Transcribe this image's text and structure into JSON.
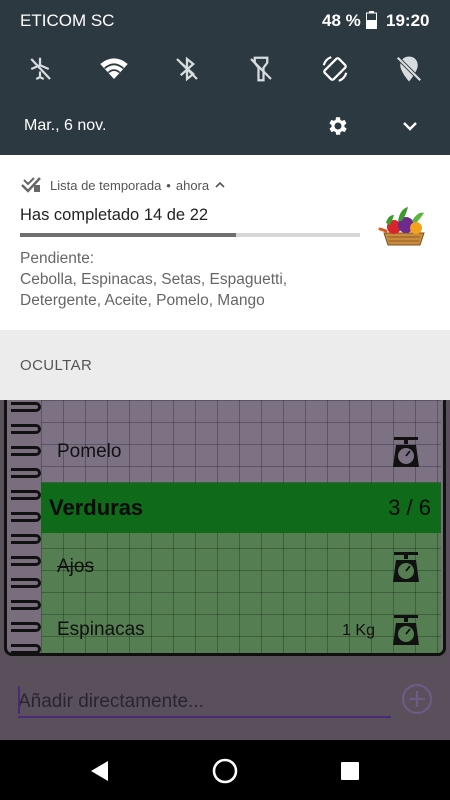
{
  "status_bar": {
    "carrier": "ETICOM SC",
    "battery_percent": "48 %",
    "time": "19:20"
  },
  "quick_settings": {
    "tiles": [
      {
        "name": "airplane-mode",
        "icon": "airplane-off-icon",
        "state": "off"
      },
      {
        "name": "wifi",
        "icon": "wifi-icon",
        "state": "on"
      },
      {
        "name": "bluetooth",
        "icon": "bluetooth-off-icon",
        "state": "off"
      },
      {
        "name": "flashlight",
        "icon": "flashlight-off-icon",
        "state": "off"
      },
      {
        "name": "auto-rotate",
        "icon": "rotate-icon",
        "state": "on"
      },
      {
        "name": "location",
        "icon": "location-off-icon",
        "state": "off"
      }
    ],
    "date": "Mar., 6 nov."
  },
  "notification": {
    "app_name": "Lista de temporada",
    "separator": "•",
    "time": "ahora",
    "title": "Has completado 14 de 22",
    "progress": {
      "completed": 14,
      "total": 22
    },
    "body_line1": "Pendiente:",
    "body_line2": "Cebolla, Espinacas, Setas, Espaguetti,",
    "body_line3": "Detergente, Aceite, Pomelo, Mango",
    "action_label": "OCULTAR"
  },
  "app": {
    "items_top": [
      {
        "label": "Pomelo",
        "qty": "",
        "done": false
      }
    ],
    "category": {
      "title": "Verduras",
      "count": "3 / 6"
    },
    "items": [
      {
        "label": "Ajos",
        "qty": "",
        "done": true
      },
      {
        "label": "Espinacas",
        "qty": "1 Kg",
        "done": false
      }
    ],
    "add_placeholder": "Añadir directamente..."
  },
  "colors": {
    "shade_bg": "#2d3940",
    "category_bg": "#0f6a1a",
    "input_accent": "#4d2a78"
  }
}
